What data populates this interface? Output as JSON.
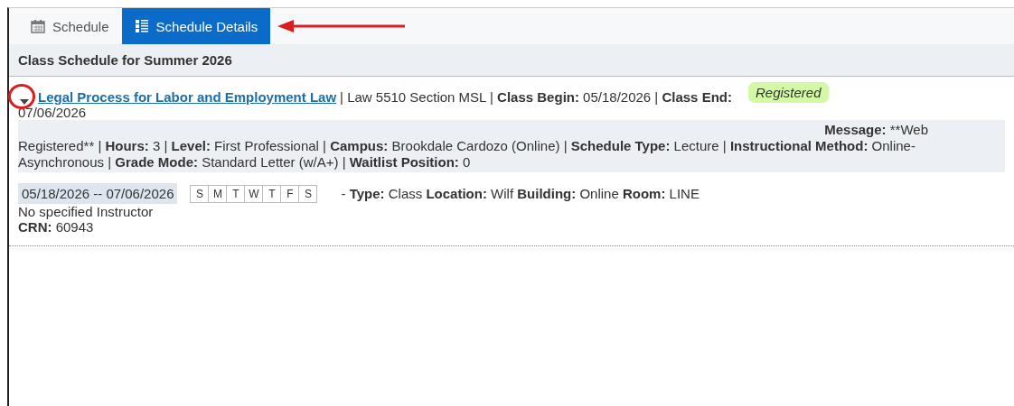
{
  "tabs": [
    {
      "label": "Schedule",
      "kind": "calendar",
      "selected": false
    },
    {
      "label": "Schedule Details",
      "kind": "list",
      "selected": true
    }
  ],
  "heading": "Class Schedule for Summer 2026",
  "course": {
    "expanded": true,
    "title": "Legal Process for Labor and Employment Law",
    "summary": "| Law 5510 Section MSL | **Class Begin:** 05/18/2026 | **Class End:**",
    "end_date": "07/06/2026",
    "status": "Registered",
    "message_label": "Message:",
    "message": "**Web",
    "details": "Registered** | **Hours:** 3 | **Level:** First Professional | **Campus:** Brookdale Cardozo (Online) | **Schedule Type:** Lecture | **Instructional Method:** Online-Asynchronous | **Grade Mode:** Standard Letter (w/A+) | **Waitlist Position:** 0",
    "meeting": {
      "dates": "05/18/2026 -- 07/06/2026",
      "days": [
        {
          "label": "S",
          "active": false
        },
        {
          "label": "M",
          "active": false
        },
        {
          "label": "T",
          "active": false
        },
        {
          "label": "W",
          "active": false
        },
        {
          "label": "T",
          "active": false
        },
        {
          "label": "F",
          "active": false
        },
        {
          "label": "S",
          "active": false
        }
      ],
      "info": "-  **Type:** Class **Location:** Wilf **Building:** Online **Room:** LINE"
    },
    "instructor": "No specified Instructor",
    "crn": "**CRN:** 60943"
  }
}
